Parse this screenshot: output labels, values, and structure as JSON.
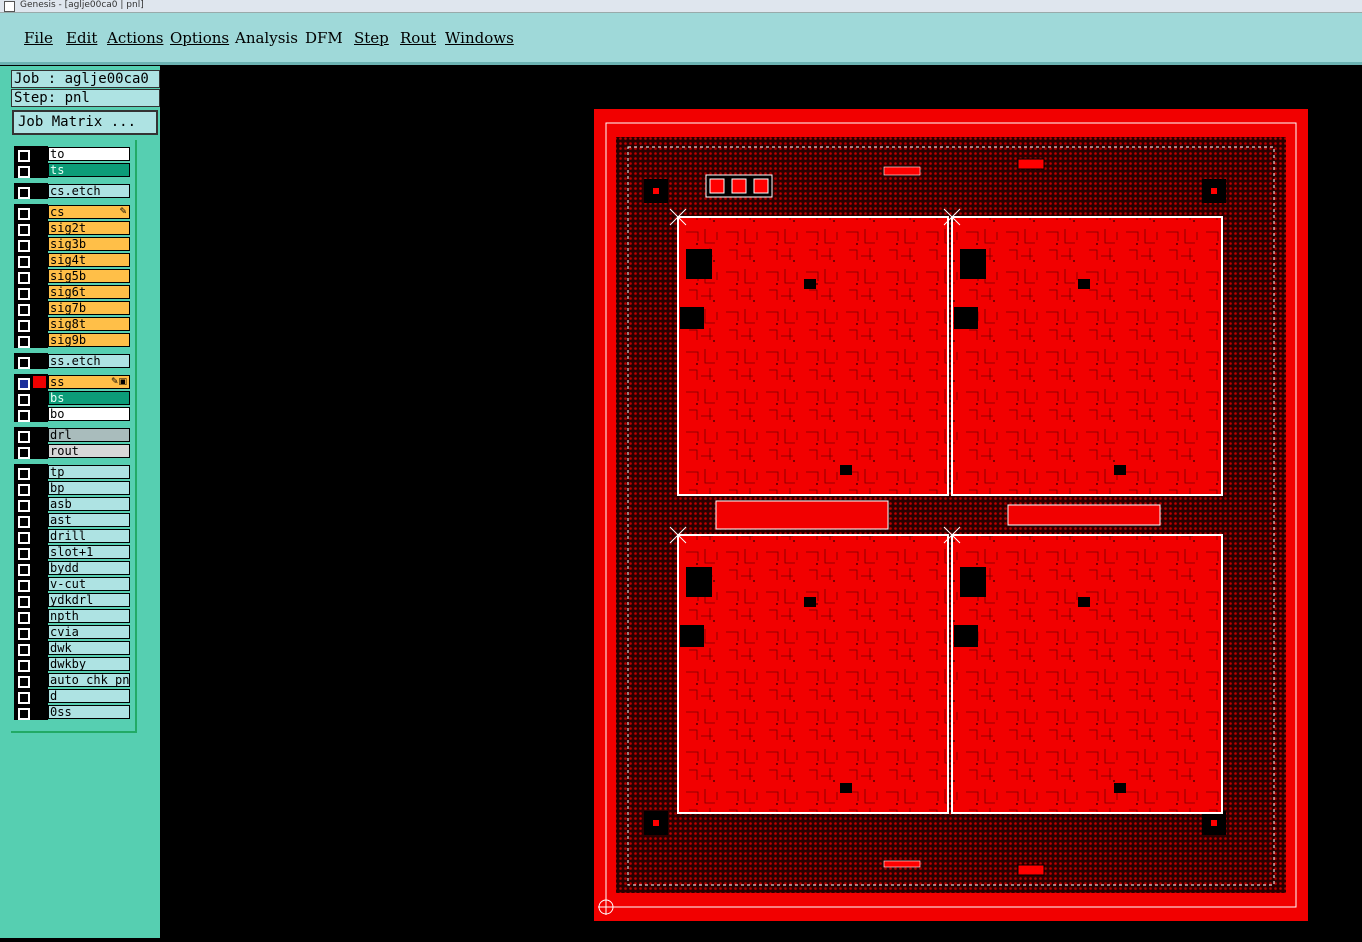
{
  "window": {
    "title": "Genesis - [aglje00ca0 | pnl]"
  },
  "menu": [
    {
      "label": "File"
    },
    {
      "label": "Edit"
    },
    {
      "label": "Actions"
    },
    {
      "label": "Options"
    },
    {
      "label": "Analysis"
    },
    {
      "label": "DFM"
    },
    {
      "label": "Step"
    },
    {
      "label": "Rout"
    },
    {
      "label": "Windows"
    }
  ],
  "job": {
    "job_label": "Job : aglje00ca0",
    "step_label": "Step: pnl",
    "matrix_button": "Job Matrix ..."
  },
  "layers": [
    {
      "name": "to",
      "color": "white"
    },
    {
      "name": "ts",
      "color": "green"
    },
    {
      "name": "cs.etch",
      "color": "cyan"
    },
    {
      "name": "cs",
      "color": "orange",
      "flag": "✎"
    },
    {
      "name": "sig2t",
      "color": "orange"
    },
    {
      "name": "sig3b",
      "color": "orange"
    },
    {
      "name": "sig4t",
      "color": "orange"
    },
    {
      "name": "sig5b",
      "color": "orange"
    },
    {
      "name": "sig6t",
      "color": "orange"
    },
    {
      "name": "sig7b",
      "color": "orange"
    },
    {
      "name": "sig8t",
      "color": "orange"
    },
    {
      "name": "sig9b",
      "color": "orange"
    },
    {
      "name": "ss.etch",
      "color": "cyan"
    },
    {
      "name": "ss",
      "color": "orange",
      "active": true,
      "flag": "✎▣"
    },
    {
      "name": "bs",
      "color": "green"
    },
    {
      "name": "bo",
      "color": "white"
    },
    {
      "name": "drl",
      "color": "grey"
    },
    {
      "name": "rout",
      "color": "lgrey"
    },
    {
      "name": "tp",
      "color": "cyan"
    },
    {
      "name": "bp",
      "color": "cyan"
    },
    {
      "name": "asb",
      "color": "cyan"
    },
    {
      "name": "ast",
      "color": "cyan"
    },
    {
      "name": "drill",
      "color": "cyan"
    },
    {
      "name": "slot+1",
      "color": "cyan"
    },
    {
      "name": "bydd",
      "color": "cyan"
    },
    {
      "name": "v-cut",
      "color": "cyan"
    },
    {
      "name": "ydkdrl",
      "color": "cyan"
    },
    {
      "name": "npth",
      "color": "cyan"
    },
    {
      "name": "cvia",
      "color": "cyan"
    },
    {
      "name": "dwk",
      "color": "cyan"
    },
    {
      "name": "dwkby",
      "color": "cyan"
    },
    {
      "name": "auto_chk_pnl",
      "color": "cyan"
    },
    {
      "name": "d",
      "color": "cyan"
    },
    {
      "name": "0ss",
      "color": "cyan"
    }
  ],
  "colors": {
    "panel_red": "#f00000",
    "copper_dark": "#3a0000",
    "menubar": "#9fd9d9",
    "layerbar": "#56cfb1"
  }
}
